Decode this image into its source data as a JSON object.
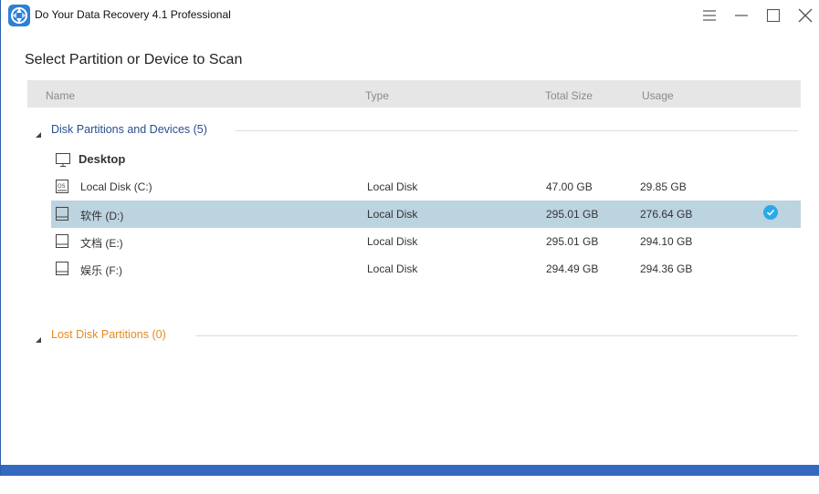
{
  "app": {
    "title": "Do Your Data Recovery 4.1 Professional",
    "icon": "app-logo-icon",
    "controls": [
      "menu-icon",
      "minimize-icon",
      "maximize-icon",
      "close-icon"
    ]
  },
  "page": {
    "title": "Select Partition or Device to Scan"
  },
  "table": {
    "columns": {
      "name": "Name",
      "type": "Type",
      "total_size": "Total Size",
      "usage": "Usage"
    }
  },
  "sections": {
    "disks": {
      "label": "Disk Partitions and Devices (5)",
      "expanded": true
    },
    "lost": {
      "label": "Lost Disk Partitions (0)",
      "expanded": true
    }
  },
  "group": {
    "label": "Desktop",
    "icon": "monitor-icon"
  },
  "rows": [
    {
      "name": "Local Disk (C:)",
      "type": "Local Disk",
      "total_size": "47.00 GB",
      "usage": "29.85 GB",
      "icon": "os-drive-icon",
      "selected": false
    },
    {
      "name": "软件 (D:)",
      "type": "Local Disk",
      "total_size": "295.01 GB",
      "usage": "276.64 GB",
      "icon": "drive-icon",
      "selected": true
    },
    {
      "name": "文档 (E:)",
      "type": "Local Disk",
      "total_size": "295.01 GB",
      "usage": "294.10 GB",
      "icon": "drive-icon",
      "selected": false
    },
    {
      "name": "娱乐 (F:)",
      "type": "Local Disk",
      "total_size": "294.49 GB",
      "usage": "294.36 GB",
      "icon": "drive-icon",
      "selected": false
    }
  ],
  "colors": {
    "section_disks": "#2a4f8f",
    "section_lost": "#e58a1f",
    "selected_row": "#bcd3e0",
    "check": "#2aa9e8",
    "bottom_bar": "#3469c0"
  }
}
